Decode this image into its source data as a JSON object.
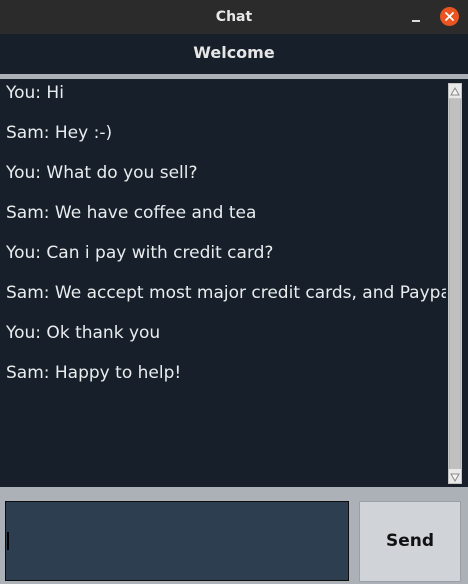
{
  "window": {
    "title": "Chat"
  },
  "header": {
    "label": "Welcome"
  },
  "messages": [
    "You: Hi",
    "Sam: Hey :-)",
    "You: What do you sell?",
    "Sam: We have coffee and tea",
    "You: Can i pay with credit card?",
    "Sam: We accept most major credit cards, and Paypal",
    "You: Ok thank you",
    "Sam: Happy to help!"
  ],
  "input": {
    "value": ""
  },
  "send_button": {
    "label": "Send"
  },
  "colors": {
    "background": "#17202a",
    "text": "#eaecee",
    "entry": "#2c3e50",
    "close_accent": "#e95420"
  },
  "icons": {
    "minimize": "minimize-icon",
    "close": "close-icon",
    "scroll_up": "arrow-up-icon",
    "scroll_down": "arrow-down-icon"
  }
}
